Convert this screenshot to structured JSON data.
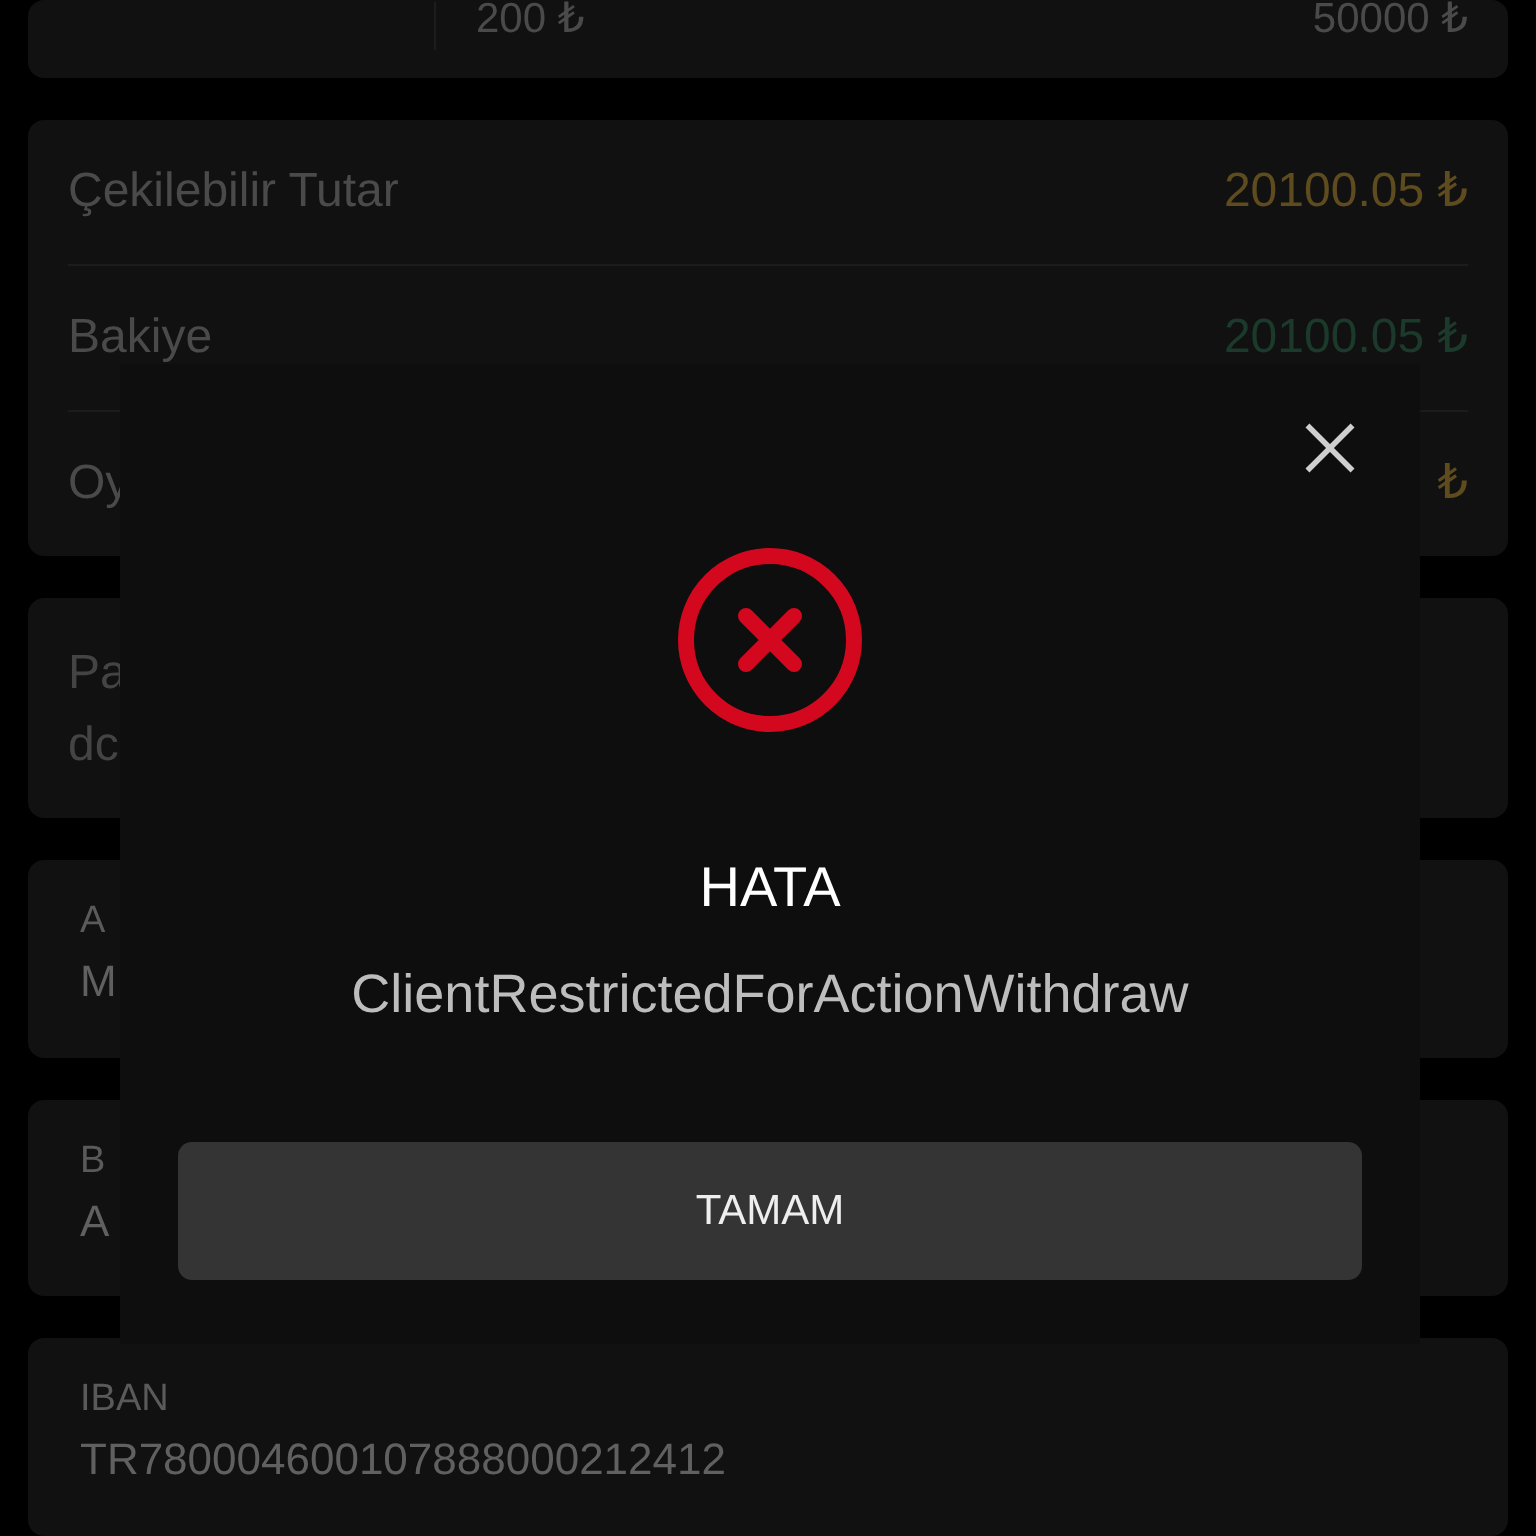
{
  "limits": {
    "min": "200 ₺",
    "max": "50000 ₺"
  },
  "summary": [
    {
      "label": "Çekilebilir Tutar",
      "value": "20100.05 ₺",
      "color": "#5e4c1f"
    },
    {
      "label": "Bakiye",
      "value": "20100.05 ₺",
      "color": "#1c3a2c"
    },
    {
      "label": "Oy",
      "value": "₺",
      "color": "#5e4c1f"
    }
  ],
  "fields": [
    {
      "kind": "text",
      "lines": [
        "Pa",
        "dc"
      ]
    },
    {
      "kind": "labeled",
      "label": "A",
      "value": "M"
    },
    {
      "kind": "labeled",
      "label": "B",
      "value": "A"
    },
    {
      "kind": "labeled",
      "label": "IBAN",
      "value": "TR780004600107888000212412"
    }
  ],
  "dialog": {
    "title": "HATA",
    "message": "ClientRestrictedForActionWithdraw",
    "button": "TAMAM"
  }
}
